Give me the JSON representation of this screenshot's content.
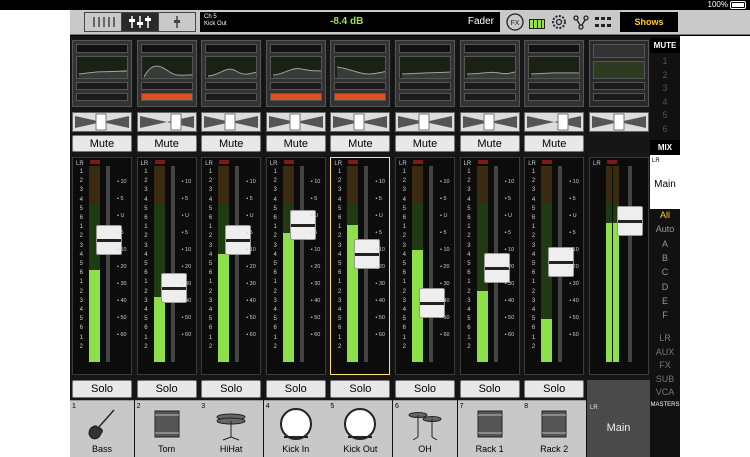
{
  "status": {
    "battery": "100%"
  },
  "topbar": {
    "channel_line1": "Ch 5",
    "channel_line2": "Kick Out",
    "level": "-8.4 dB",
    "mode": "Fader",
    "fx_label": "FX",
    "shows_label": "Shows",
    "icons": [
      "view-mixer-icon",
      "view-fader-icon",
      "view-single-icon",
      "fx-icon",
      "meter-grid-icon",
      "gear-icon",
      "routing-icon",
      "layout-icon"
    ]
  },
  "scale_left": [
    "1",
    "2",
    "3",
    "4",
    "5",
    "6",
    "1",
    "2",
    "3",
    "4",
    "5",
    "6",
    "1",
    "2",
    "3",
    "4",
    "5",
    "6",
    "1",
    "2",
    "3",
    "4",
    "5",
    "6"
  ],
  "scale_right": [
    "10",
    "5",
    "U",
    "5",
    "10",
    "20",
    "30",
    "40",
    "50",
    "60"
  ],
  "lr_label": "LR",
  "mute_label": "Mute",
  "solo_label": "Solo",
  "channels": [
    {
      "num": "1",
      "name": "Bass",
      "icon": "bass-guitar-icon",
      "meter": 0.47,
      "fader": 0.62
    },
    {
      "num": "2",
      "name": "Tom",
      "icon": "drum-icon",
      "meter": 0.33,
      "fader": 0.38
    },
    {
      "num": "3",
      "name": "HiHat",
      "icon": "hihat-icon",
      "meter": 0.55,
      "fader": 0.62
    },
    {
      "num": "4",
      "name": "Kick In",
      "icon": "kick-drum-icon",
      "meter": 0.66,
      "fader": 0.7
    },
    {
      "num": "5",
      "name": "Kick Out",
      "icon": "kick-drum-icon",
      "meter": 0.7,
      "fader": 0.55
    },
    {
      "num": "6",
      "name": "OH",
      "icon": "cymbal-icon",
      "meter": 0.57,
      "fader": 0.3
    },
    {
      "num": "7",
      "name": "Rack 1",
      "icon": "drum-icon",
      "meter": 0.36,
      "fader": 0.48
    },
    {
      "num": "8",
      "name": "Rack 2",
      "icon": "drum-icon",
      "meter": 0.22,
      "fader": 0.51
    }
  ],
  "main_strip": {
    "lr": "LR",
    "name": "Main",
    "meter": 0.71,
    "fader": 0.72
  },
  "side": {
    "mute_header": "MUTE",
    "mute_groups": [
      "1",
      "2",
      "3",
      "4",
      "5",
      "6"
    ],
    "mix_header": "MIX",
    "mix_lr": "LR",
    "mix_name": "Main",
    "filters": [
      "All",
      "Auto",
      "A",
      "B",
      "C",
      "D",
      "E",
      "F"
    ],
    "groups": [
      "LR",
      "AUX",
      "FX",
      "SUB",
      "VCA"
    ],
    "masters": "MASTERS"
  },
  "colors": {
    "accent": "#ffcc1a",
    "meter": "#8ee04a",
    "level": "#9be14d"
  }
}
